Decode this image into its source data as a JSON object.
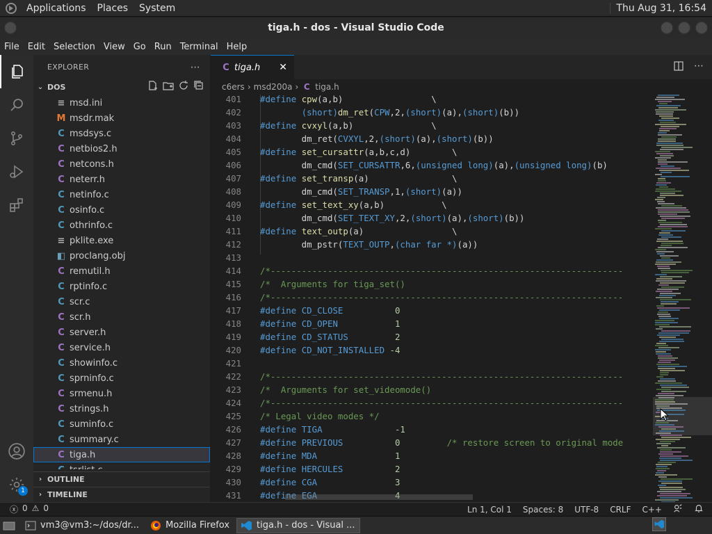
{
  "top_panel": {
    "menus": [
      "Applications",
      "Places",
      "System"
    ],
    "clock": "Thu Aug 31, 16:54"
  },
  "window": {
    "title": "tiga.h - dos - Visual Studio Code"
  },
  "menubar": [
    "File",
    "Edit",
    "Selection",
    "View",
    "Go",
    "Run",
    "Terminal",
    "Help"
  ],
  "activity_bar": {
    "icons": [
      "explorer-icon",
      "search-icon",
      "source-control-icon",
      "run-debug-icon",
      "extensions-icon",
      "account-icon",
      "settings-gear-icon"
    ],
    "settings_badge": "1"
  },
  "sidebar": {
    "header": "EXPLORER",
    "folder": "DOS",
    "files": [
      {
        "name": "msd.ini",
        "type": "ini",
        "glyph": "≡"
      },
      {
        "name": "msdr.mak",
        "type": "m",
        "glyph": "M"
      },
      {
        "name": "msdsys.c",
        "type": "c",
        "glyph": "C"
      },
      {
        "name": "netbios2.h",
        "type": "h",
        "glyph": "C"
      },
      {
        "name": "netcons.h",
        "type": "h",
        "glyph": "C"
      },
      {
        "name": "neterr.h",
        "type": "h",
        "glyph": "C"
      },
      {
        "name": "netinfo.c",
        "type": "c",
        "glyph": "C"
      },
      {
        "name": "osinfo.c",
        "type": "c",
        "glyph": "C"
      },
      {
        "name": "othrinfo.c",
        "type": "c",
        "glyph": "C"
      },
      {
        "name": "pklite.exe",
        "type": "exe",
        "glyph": "≡"
      },
      {
        "name": "proclang.obj",
        "type": "obj",
        "glyph": "◧"
      },
      {
        "name": "remutil.h",
        "type": "h",
        "glyph": "C"
      },
      {
        "name": "rptinfo.c",
        "type": "c",
        "glyph": "C"
      },
      {
        "name": "scr.c",
        "type": "c",
        "glyph": "C"
      },
      {
        "name": "scr.h",
        "type": "h",
        "glyph": "C"
      },
      {
        "name": "server.h",
        "type": "h",
        "glyph": "C"
      },
      {
        "name": "service.h",
        "type": "h",
        "glyph": "C"
      },
      {
        "name": "showinfo.c",
        "type": "c",
        "glyph": "C"
      },
      {
        "name": "sprninfo.c",
        "type": "c",
        "glyph": "C"
      },
      {
        "name": "srmenu.h",
        "type": "h",
        "glyph": "C"
      },
      {
        "name": "strings.h",
        "type": "h",
        "glyph": "C"
      },
      {
        "name": "suminfo.c",
        "type": "c",
        "glyph": "C"
      },
      {
        "name": "summary.c",
        "type": "c",
        "glyph": "C"
      },
      {
        "name": "tiga.h",
        "type": "h",
        "glyph": "C",
        "selected": true
      },
      {
        "name": "tsrlist.c",
        "type": "c",
        "glyph": "C"
      }
    ],
    "outline_label": "OUTLINE",
    "timeline_label": "TIMELINE"
  },
  "tab": {
    "label": "tiga.h",
    "close": "✕"
  },
  "breadcrumb": [
    "c6ers",
    "msd200a",
    "tiga.h"
  ],
  "editor": {
    "lines": [
      {
        "n": "401",
        "tokens": [
          [
            "pp",
            "#define "
          ],
          [
            "fn",
            "cpw"
          ],
          [
            "id",
            "(a,b)                 \\"
          ]
        ]
      },
      {
        "n": "402",
        "tokens": [
          [
            "id",
            "        "
          ],
          [
            "ty",
            "(short)"
          ],
          [
            "fn",
            "dm_ret"
          ],
          [
            "id",
            "("
          ],
          [
            "mac",
            "CPW"
          ],
          [
            "id",
            ",2,"
          ],
          [
            "ty",
            "(short)"
          ],
          [
            "id",
            "(a),"
          ],
          [
            "ty",
            "(short)"
          ],
          [
            "id",
            "(b))"
          ]
        ]
      },
      {
        "n": "403",
        "tokens": [
          [
            "pp",
            "#define "
          ],
          [
            "fn",
            "cvxyl"
          ],
          [
            "id",
            "(a,b)               \\"
          ]
        ]
      },
      {
        "n": "404",
        "tokens": [
          [
            "id",
            "        dm_ret("
          ],
          [
            "mac",
            "CVXYL"
          ],
          [
            "id",
            ",2,"
          ],
          [
            "ty",
            "(short)"
          ],
          [
            "id",
            "(a),"
          ],
          [
            "ty",
            "(short)"
          ],
          [
            "id",
            "(b))"
          ]
        ]
      },
      {
        "n": "405",
        "tokens": [
          [
            "pp",
            "#define "
          ],
          [
            "fn",
            "set_cursattr"
          ],
          [
            "id",
            "(a,b,c,d)        \\"
          ]
        ]
      },
      {
        "n": "406",
        "tokens": [
          [
            "id",
            "        dm_cmd("
          ],
          [
            "mac",
            "SET_CURSATTR"
          ],
          [
            "id",
            ",6,"
          ],
          [
            "ty",
            "(unsigned long)"
          ],
          [
            "id",
            "(a),"
          ],
          [
            "ty",
            "(unsigned long)"
          ],
          [
            "id",
            "(b)"
          ]
        ]
      },
      {
        "n": "407",
        "tokens": [
          [
            "pp",
            "#define "
          ],
          [
            "fn",
            "set_transp"
          ],
          [
            "id",
            "(a)                \\"
          ]
        ]
      },
      {
        "n": "408",
        "tokens": [
          [
            "id",
            "        dm_cmd("
          ],
          [
            "mac",
            "SET_TRANSP"
          ],
          [
            "id",
            ",1,"
          ],
          [
            "ty",
            "(short)"
          ],
          [
            "id",
            "(a))"
          ]
        ]
      },
      {
        "n": "409",
        "tokens": [
          [
            "pp",
            "#define "
          ],
          [
            "fn",
            "set_text_xy"
          ],
          [
            "id",
            "(a,b)           \\"
          ]
        ]
      },
      {
        "n": "410",
        "tokens": [
          [
            "id",
            "        dm_cmd("
          ],
          [
            "mac",
            "SET_TEXT_XY"
          ],
          [
            "id",
            ",2,"
          ],
          [
            "ty",
            "(short)"
          ],
          [
            "id",
            "(a),"
          ],
          [
            "ty",
            "(short)"
          ],
          [
            "id",
            "(b))"
          ]
        ]
      },
      {
        "n": "411",
        "tokens": [
          [
            "pp",
            "#define "
          ],
          [
            "fn",
            "text_outp"
          ],
          [
            "id",
            "(a)                 \\"
          ]
        ]
      },
      {
        "n": "412",
        "tokens": [
          [
            "id",
            "        dm_pstr("
          ],
          [
            "mac",
            "TEXT_OUTP"
          ],
          [
            "id",
            ","
          ],
          [
            "ty",
            "(char far *)"
          ],
          [
            "id",
            "(a))"
          ]
        ]
      },
      {
        "n": "413",
        "tokens": []
      },
      {
        "n": "414",
        "tokens": [
          [
            "cm",
            "/*--------------------------------------------------------------------"
          ]
        ]
      },
      {
        "n": "415",
        "tokens": [
          [
            "cm",
            "/*  Arguments for tiga_set()"
          ]
        ]
      },
      {
        "n": "416",
        "tokens": [
          [
            "cm",
            "/*--------------------------------------------------------------------"
          ]
        ]
      },
      {
        "n": "417",
        "tokens": [
          [
            "pp",
            "#define "
          ],
          [
            "mac",
            "CD_CLOSE"
          ],
          [
            "id",
            "          "
          ],
          [
            "num",
            "0"
          ]
        ]
      },
      {
        "n": "418",
        "tokens": [
          [
            "pp",
            "#define "
          ],
          [
            "mac",
            "CD_OPEN"
          ],
          [
            "id",
            "           "
          ],
          [
            "num",
            "1"
          ]
        ]
      },
      {
        "n": "419",
        "tokens": [
          [
            "pp",
            "#define "
          ],
          [
            "mac",
            "CD_STATUS"
          ],
          [
            "id",
            "         "
          ],
          [
            "num",
            "2"
          ]
        ]
      },
      {
        "n": "420",
        "tokens": [
          [
            "pp",
            "#define "
          ],
          [
            "mac",
            "CD_NOT_INSTALLED"
          ],
          [
            "id",
            " "
          ],
          [
            "num",
            "-4"
          ]
        ]
      },
      {
        "n": "421",
        "tokens": []
      },
      {
        "n": "422",
        "tokens": [
          [
            "cm",
            "/*--------------------------------------------------------------------"
          ]
        ]
      },
      {
        "n": "423",
        "tokens": [
          [
            "cm",
            "/*  Arguments for set_videomode()"
          ]
        ]
      },
      {
        "n": "424",
        "tokens": [
          [
            "cm",
            "/*--------------------------------------------------------------------"
          ]
        ]
      },
      {
        "n": "425",
        "tokens": [
          [
            "cm",
            "/* Legal video modes */"
          ]
        ]
      },
      {
        "n": "426",
        "tokens": [
          [
            "pp",
            "#define "
          ],
          [
            "mac",
            "TIGA"
          ],
          [
            "id",
            "              "
          ],
          [
            "num",
            "-1"
          ]
        ]
      },
      {
        "n": "427",
        "tokens": [
          [
            "pp",
            "#define "
          ],
          [
            "mac",
            "PREVIOUS"
          ],
          [
            "id",
            "          "
          ],
          [
            "num",
            "0"
          ],
          [
            "id",
            "         "
          ],
          [
            "cm",
            "/* restore screen to original mode"
          ]
        ]
      },
      {
        "n": "428",
        "tokens": [
          [
            "pp",
            "#define "
          ],
          [
            "mac",
            "MDA"
          ],
          [
            "id",
            "               "
          ],
          [
            "num",
            "1"
          ]
        ]
      },
      {
        "n": "429",
        "tokens": [
          [
            "pp",
            "#define "
          ],
          [
            "mac",
            "HERCULES"
          ],
          [
            "id",
            "          "
          ],
          [
            "num",
            "2"
          ]
        ]
      },
      {
        "n": "430",
        "tokens": [
          [
            "pp",
            "#define "
          ],
          [
            "mac",
            "CGA"
          ],
          [
            "id",
            "               "
          ],
          [
            "num",
            "3"
          ]
        ]
      },
      {
        "n": "431",
        "tokens": [
          [
            "pp",
            "#define "
          ],
          [
            "mac",
            "EGA"
          ],
          [
            "id",
            "               "
          ],
          [
            "num",
            "4"
          ]
        ]
      }
    ]
  },
  "statusbar": {
    "errors": "0",
    "warnings": "0",
    "position": "Ln 1, Col 1",
    "spaces": "Spaces: 8",
    "encoding": "UTF-8",
    "eol": "CRLF",
    "language": "C++"
  },
  "taskbar": {
    "items": [
      {
        "label": "vm3@vm3:~/dos/dr...",
        "icon": "terminal-icon"
      },
      {
        "label": "Mozilla Firefox",
        "icon": "firefox-icon"
      },
      {
        "label": "tiga.h - dos - Visual ...",
        "icon": "vscode-icon",
        "active": true
      }
    ]
  },
  "colors": {
    "accent": "#0078d4",
    "editor_bg": "#1e1e1e",
    "sidebar_bg": "#252526",
    "comment": "#6a9955",
    "macro": "#569cd6",
    "function": "#dcdcaa",
    "number": "#b5cea8"
  }
}
